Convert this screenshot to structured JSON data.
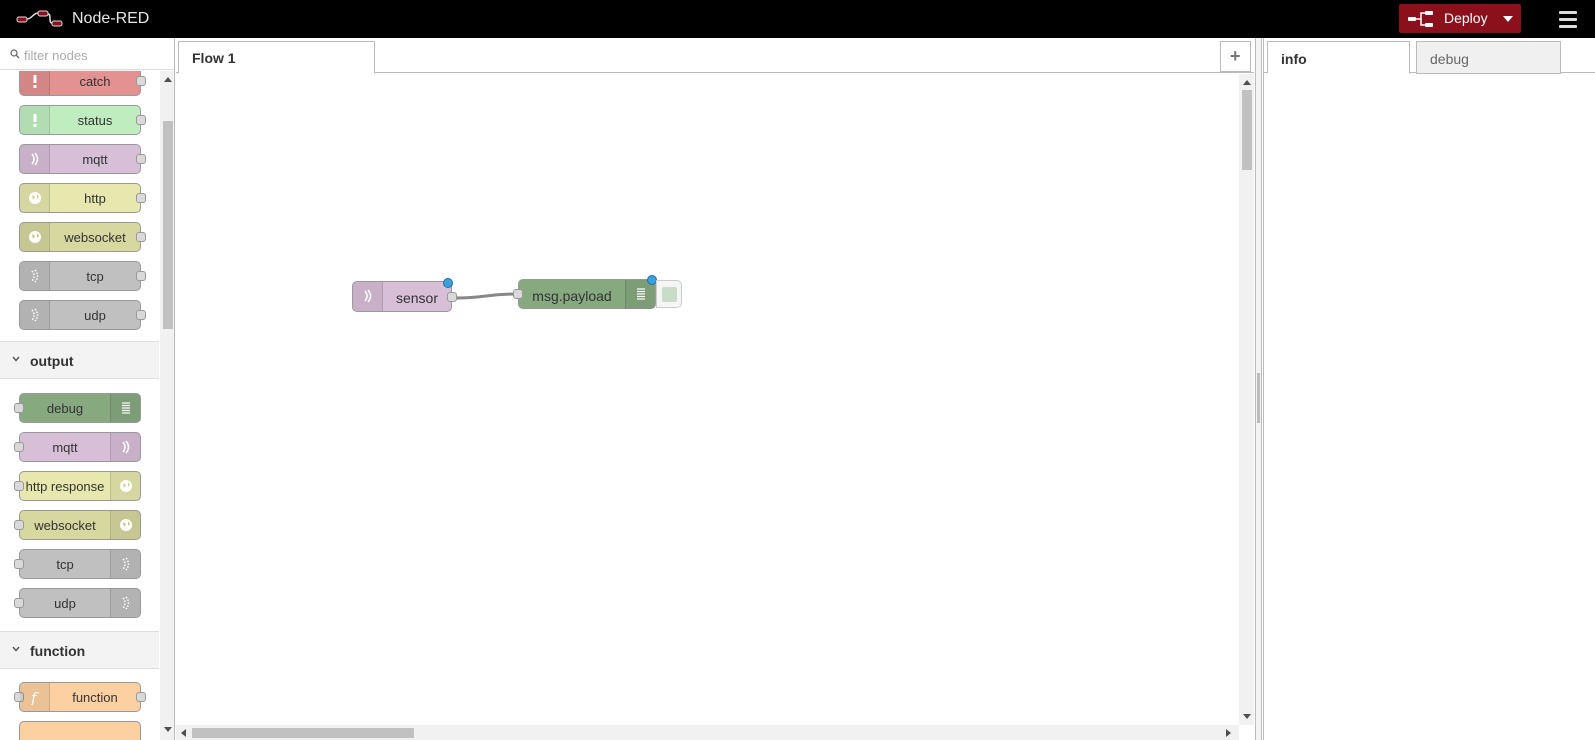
{
  "header": {
    "title": "Node-RED",
    "deploy_label": "Deploy",
    "icons": {
      "logo": "node-red-logo-icon",
      "deploy": "deploy-flow-icon",
      "caret": "caret-down-icon",
      "menu": "hamburger-menu-icon"
    }
  },
  "palette": {
    "search_placeholder": "filter nodes",
    "input_nodes": [
      {
        "label": "catch",
        "color": "#e49191",
        "icon": "alert-icon"
      },
      {
        "label": "status",
        "color": "#c0edc0",
        "icon": "alert-icon"
      },
      {
        "label": "mqtt",
        "color": "#d8bfd8",
        "icon": "bridge-icon"
      },
      {
        "label": "http",
        "color": "#e7e7ae",
        "icon": "white-globe-icon"
      },
      {
        "label": "websocket",
        "color": "#d7d7a0",
        "icon": "white-globe-icon"
      },
      {
        "label": "tcp",
        "color": "#c0c0c0",
        "icon": "bridge-dash-icon"
      },
      {
        "label": "udp",
        "color": "#c0c0c0",
        "icon": "bridge-dash-icon"
      }
    ],
    "categories": {
      "output": "output",
      "function": "function"
    },
    "output_nodes": [
      {
        "label": "debug",
        "color": "#87a980",
        "icon": "debug-list-icon"
      },
      {
        "label": "mqtt",
        "color": "#d8bfd8",
        "icon": "bridge-icon"
      },
      {
        "label": "http response",
        "color": "#e7e7ae",
        "icon": "white-globe-icon"
      },
      {
        "label": "websocket",
        "color": "#d7d7a0",
        "icon": "white-globe-icon"
      },
      {
        "label": "tcp",
        "color": "#c0c0c0",
        "icon": "bridge-dash-icon"
      },
      {
        "label": "udp",
        "color": "#c0c0c0",
        "icon": "bridge-dash-icon"
      }
    ],
    "function_nodes": [
      {
        "label": "function",
        "color": "#fdd0a2",
        "icon": "function-icon"
      }
    ]
  },
  "workspace": {
    "tabs": [
      {
        "label": "Flow 1"
      }
    ],
    "add_tab_label": "+",
    "flow_nodes": {
      "sensor": {
        "label": "sensor",
        "color": "#d8bfd8",
        "icon": "bridge-icon"
      },
      "debug": {
        "label": "msg.payload",
        "color": "#87a980",
        "icon": "debug-list-icon"
      }
    }
  },
  "sidebar": {
    "tabs": [
      {
        "label": "info",
        "active": true
      },
      {
        "label": "debug",
        "active": false
      }
    ]
  }
}
